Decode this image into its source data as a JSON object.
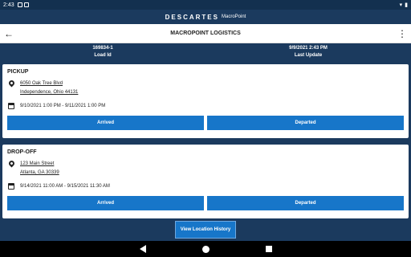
{
  "status": {
    "time": "2:43"
  },
  "brand": {
    "name": "DESCARTES",
    "product": "MacroPoint"
  },
  "appbar": {
    "title": "MACROPOINT LOGISTICS",
    "back_icon": "arrow-left-icon",
    "menu_icon": "more-vert-icon"
  },
  "info": {
    "load_id": "169834-1",
    "load_id_label": "Load Id",
    "last_update": "9/9/2021 2:43 PM",
    "last_update_label": "Last Update"
  },
  "pickup": {
    "heading": "PICKUP",
    "address_line1": "6050 Oak Tree Blvd",
    "address_line2": "Independence, Ohio 44131",
    "window": "9/10/2021 1:00 PM - 9/11/2021 1:00 PM",
    "arrived_label": "Arrived",
    "departed_label": "Departed"
  },
  "dropoff": {
    "heading": "DROP-OFF",
    "address_line1": "123 Main Street",
    "address_line2": "Atlanta, GA 30339",
    "window": "9/14/2021 11:00 AM - 9/15/2021 11:30 AM",
    "arrived_label": "Arrived",
    "departed_label": "Departed"
  },
  "footer": {
    "history_label": "View Location History"
  },
  "colors": {
    "navy": "#1b3a5e",
    "button_blue": "#1776c9"
  }
}
